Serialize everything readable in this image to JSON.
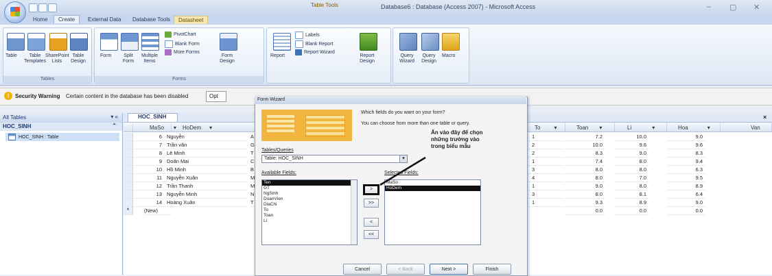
{
  "window": {
    "title": "Database6 : Database (Access 2007) - Microsoft Access",
    "contextual_tab_group": "Table Tools",
    "controls": [
      "–",
      "▢",
      "✕"
    ]
  },
  "ribbon_tabs": [
    "Home",
    "Create",
    "External Data",
    "Database Tools",
    "Datasheet"
  ],
  "ribbon": {
    "tables_group": {
      "label": "Tables",
      "items": [
        "Table",
        "Table Templates",
        "SharePoint Lists",
        "Table Design"
      ]
    },
    "forms_group": {
      "label": "Forms",
      "items": [
        "Form",
        "Split Form",
        "Multiple Items"
      ],
      "small_items": [
        "PivotChart",
        "Blank Form",
        "More Forms",
        "Form Design"
      ]
    },
    "reports_group": {
      "items": [
        "Report",
        "Labels",
        "Blank Report",
        "Report Wizard",
        "Report Design"
      ]
    },
    "other_group": {
      "items": [
        "Query Wizard",
        "Query Design",
        "Macro"
      ]
    }
  },
  "security_bar": {
    "label": "Security Warning",
    "message": "Certain content in the database has been disabled",
    "options_button": "Opt"
  },
  "nav_pane": {
    "header": "All Tables",
    "group": "HOC_SINH",
    "item": "HOC_SINH : Table"
  },
  "sheet": {
    "tab_label": "HOC_SINH",
    "columns": [
      "MaSo",
      "HoDem",
      "To",
      "Toan",
      "Li",
      "Hoa",
      "Van"
    ],
    "rows": [
      {
        "maso": "6",
        "hodem": "Nguyễn",
        "extra": "A",
        "to": "1",
        "toan": "7.2",
        "li": "10.0",
        "hoa": "9.0"
      },
      {
        "maso": "7",
        "hodem": "Trần văn",
        "extra": "G",
        "to": "2",
        "toan": "10.0",
        "li": "9.6",
        "hoa": "9.6"
      },
      {
        "maso": "8",
        "hodem": "Lê Minh",
        "extra": "T",
        "to": "2",
        "toan": "8.3",
        "li": "9.0",
        "hoa": "8.3"
      },
      {
        "maso": "9",
        "hodem": "Doãn Mai",
        "extra": "C",
        "to": "1",
        "toan": "7.4",
        "li": "8.0",
        "hoa": "9.4"
      },
      {
        "maso": "10",
        "hodem": "Hồ Minh",
        "extra": "B",
        "to": "3",
        "toan": "8.0",
        "li": "8.0",
        "hoa": "6.3"
      },
      {
        "maso": "11",
        "hodem": "Nguyễn Xuân",
        "extra": "M",
        "to": "4",
        "toan": "8.0",
        "li": "7.0",
        "hoa": "9.5"
      },
      {
        "maso": "12",
        "hodem": "Trần Thanh",
        "extra": "M",
        "to": "1",
        "toan": "9.0",
        "li": "8.0",
        "hoa": "8.9"
      },
      {
        "maso": "13",
        "hodem": "Nguyễn Minh",
        "extra": "N",
        "to": "3",
        "toan": "8.0",
        "li": "8.1",
        "hoa": "6.4"
      },
      {
        "maso": "14",
        "hodem": "Hoàng Xuân",
        "extra": "T",
        "to": "1",
        "toan": "9.3",
        "li": "8.9",
        "hoa": "9.0"
      }
    ],
    "new_row": {
      "label": "(New)",
      "toan": "0.0",
      "li": "0.0",
      "hoa": "0.0"
    }
  },
  "dialog": {
    "title": "Form Wizard",
    "question": "Which fields do you want on your form?",
    "hint": "You can choose from more than one table or query.",
    "tables_queries_label": "Tables/Queries",
    "table_select": "Table: HOC_SINH",
    "available_label": "Available Fields:",
    "selected_label": "Selected Fields:",
    "available_fields": [
      "Ten",
      "GT",
      "NgSinh",
      "DoanVien",
      "DiaChi",
      "To",
      "Toan",
      "Li"
    ],
    "selected_fields": [
      "MaSo",
      "HoDem"
    ],
    "move_buttons": [
      ">",
      ">>",
      "<",
      "<<"
    ],
    "buttons": {
      "cancel": "Cancel",
      "back": "< Back",
      "next": "Next >",
      "finish": "Finish"
    }
  },
  "annotation": "Ấn vào đây để chọn những trường vào trong biểu mẫu",
  "colors": {
    "accent": "#3d6fb6",
    "wizard_graphic": "#f2b640",
    "selection": "#101010"
  }
}
